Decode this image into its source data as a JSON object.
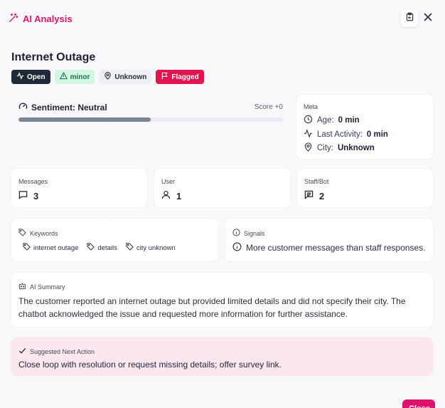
{
  "header": {
    "title": "AI Analysis"
  },
  "ticket": {
    "title": "Internet Outage"
  },
  "badges": {
    "status": "Open",
    "severity": "minor",
    "location": "Unknown",
    "flag": "Flagged"
  },
  "sentiment": {
    "label": "Sentiment: Neutral",
    "score_text": "Score +0",
    "fill_fraction": 0.5
  },
  "meta": {
    "label": "Meta",
    "age_label": "Age:",
    "age_value": "0 min",
    "last_activity_label": "Last Activity:",
    "last_activity_value": "0 min",
    "city_label": "City:",
    "city_value": "Unknown"
  },
  "stats": {
    "messages": {
      "label": "Messages",
      "value": "3"
    },
    "user": {
      "label": "User",
      "value": "1"
    },
    "staff_bot": {
      "label": "Staff/Bot",
      "value": "2"
    }
  },
  "keywords": {
    "label": "Keywords",
    "items": [
      "internet outage",
      "details",
      "city unknown"
    ]
  },
  "signals": {
    "label": "Signals",
    "items": [
      "More customer messages than staff responses."
    ]
  },
  "summary": {
    "label": "AI Summary",
    "text": "The customer reported an internet outage but provided limited details and did not specify their city. The chatbot acknowledged the issue and requested more information for further assistance."
  },
  "next_action": {
    "label": "Suggested Next Action",
    "text": "Close loop with resolution or request missing details; offer survey link."
  },
  "footer": {
    "close_label": "Close"
  },
  "colors": {
    "accent": "#e0126f",
    "flag": "#e2134f",
    "status_dark": "#1f2937",
    "severity_bg": "#d5f5e3",
    "next_action_bg": "#fce7ee"
  }
}
